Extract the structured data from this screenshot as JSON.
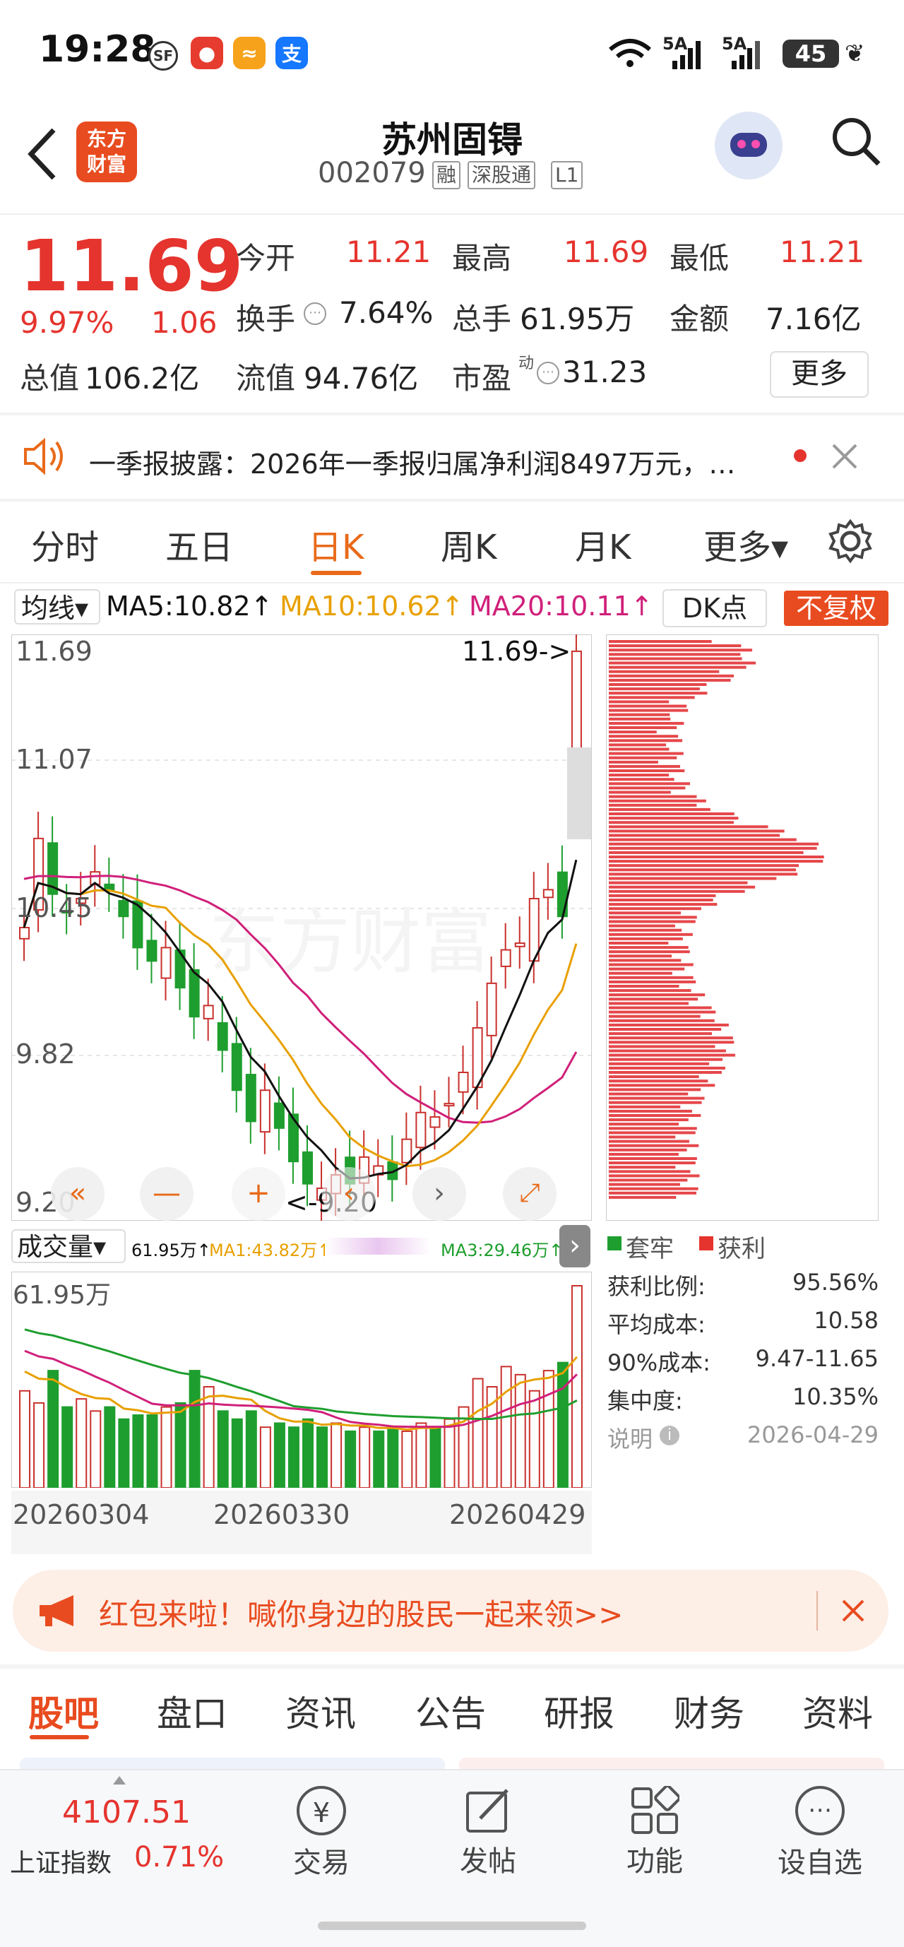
{
  "status_bar": {
    "time": "19:28",
    "signal": "5A",
    "battery": "45",
    "app_icons": [
      "sf-icon",
      "red-app-icon",
      "yellow-app-icon",
      "alipay-icon"
    ],
    "alipay_label": "支"
  },
  "header": {
    "back_icon": "chevron-left-icon",
    "logo_text_line1": "东方",
    "logo_text_line2": "财富",
    "stock_name": "苏州固锝",
    "stock_code": "002079",
    "tags": [
      "融",
      "深股通",
      "L1"
    ],
    "search_icon": "search-icon"
  },
  "quote": {
    "price": "11.69",
    "change_pct": "9.97%",
    "change_amt": "1.06",
    "open_label": "今开",
    "open": "11.21",
    "high_label": "最高",
    "high": "11.69",
    "low_label": "最低",
    "low": "11.21",
    "turnover_label": "换手",
    "turnover": "7.64%",
    "volume_label": "总手",
    "volume": "61.95万",
    "amount_label": "金额",
    "amount": "7.16亿",
    "mktcap_label": "总值",
    "mktcap": "106.2亿",
    "float_label": "流值",
    "float_cap": "94.76亿",
    "pe_label": "市盈",
    "pe_sup": "动",
    "pe": "31.23",
    "more_label": "更多"
  },
  "notice": {
    "text": "一季报披露：2026年一季报归属净利润8497万元，…",
    "speaker_icon": "speaker-icon",
    "close_icon": "close-icon"
  },
  "chart_tabs": {
    "items": [
      "分时",
      "五日",
      "日K",
      "周K",
      "月K",
      "更多▾"
    ],
    "active": "日K",
    "settings_icon": "gear-icon"
  },
  "ma_bar": {
    "selector": "均线▾",
    "ma5": "MA5:10.82↑",
    "ma10": "MA10:10.62↑",
    "ma20": "MA20:10.11↑",
    "dk": "DK点",
    "rights": "不复权",
    "colors": {
      "ma5": "#111111",
      "ma10": "#e8a000",
      "ma20": "#d0207a"
    }
  },
  "kline": {
    "y_labels": [
      "11.69",
      "11.07",
      "10.45",
      "9.82",
      "9.20"
    ],
    "max_annotation": "11.69->",
    "min_annotation": "<-9.20",
    "watermark": "东方财富",
    "controls": [
      "chevrons-left-icon",
      "minus-icon",
      "plus-icon",
      "chevron-left-icon",
      "chevron-right-icon",
      "expand-icon"
    ]
  },
  "volume_bar": {
    "selector": "成交量▾",
    "vol": "61.95万↑",
    "ma1": "MA1:43.82万↑",
    "ma3": "MA3:29.46万↑",
    "max_label": "61.95万",
    "dates": [
      "20260304",
      "20260330",
      "20260429"
    ]
  },
  "chip": {
    "legend_trapped": "套牢",
    "legend_profit": "获利",
    "rows": [
      {
        "label": "获利比例:",
        "value": "95.56%"
      },
      {
        "label": "平均成本:",
        "value": "10.58"
      },
      {
        "label": "90%成本:",
        "value": "9.47-11.65"
      },
      {
        "label": "集中度:",
        "value": "10.35%"
      }
    ],
    "note_label": "说明",
    "note_date": "2026-04-29"
  },
  "promo": {
    "text": "红包来啦！喊你身边的股民一起来领>>",
    "close_icon": "close-icon"
  },
  "sub_tabs": {
    "items": [
      "股吧",
      "盘口",
      "资讯",
      "公告",
      "研报",
      "财务",
      "资料"
    ],
    "active": "股吧"
  },
  "bottom_nav": {
    "index_value": "4107.51",
    "index_name": "上证指数",
    "index_pct": "0.71%",
    "items": [
      {
        "label": "交易",
        "icon": "yen-trade-icon"
      },
      {
        "label": "发帖",
        "icon": "edit-icon"
      },
      {
        "label": "功能",
        "icon": "grid-icon"
      },
      {
        "label": "设自选",
        "icon": "more-icon"
      }
    ]
  }
}
